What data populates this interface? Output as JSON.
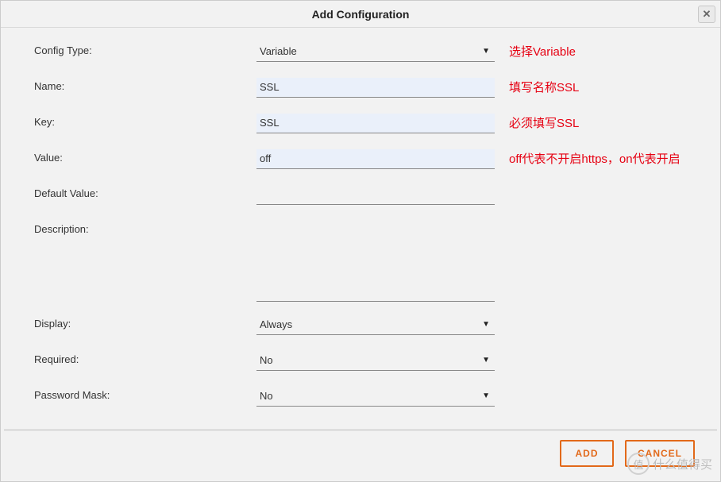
{
  "dialog": {
    "title": "Add Configuration"
  },
  "labels": {
    "config_type": "Config Type:",
    "name": "Name:",
    "key": "Key:",
    "value": "Value:",
    "default_value": "Default Value:",
    "description": "Description:",
    "display": "Display:",
    "required": "Required:",
    "password_mask": "Password Mask:"
  },
  "fields": {
    "config_type": "Variable",
    "name": "SSL",
    "key": "SSL",
    "value": "off",
    "default_value": "",
    "description": "",
    "display": "Always",
    "required": "No",
    "password_mask": "No"
  },
  "annotations": {
    "config_type": "选择Variable",
    "name": "填写名称SSL",
    "key": "必须填写SSL",
    "value": "off代表不开启https，on代表开启"
  },
  "buttons": {
    "add": "ADD",
    "cancel": "CANCEL"
  },
  "watermark": {
    "icon": "值",
    "text": "什么值得买"
  }
}
